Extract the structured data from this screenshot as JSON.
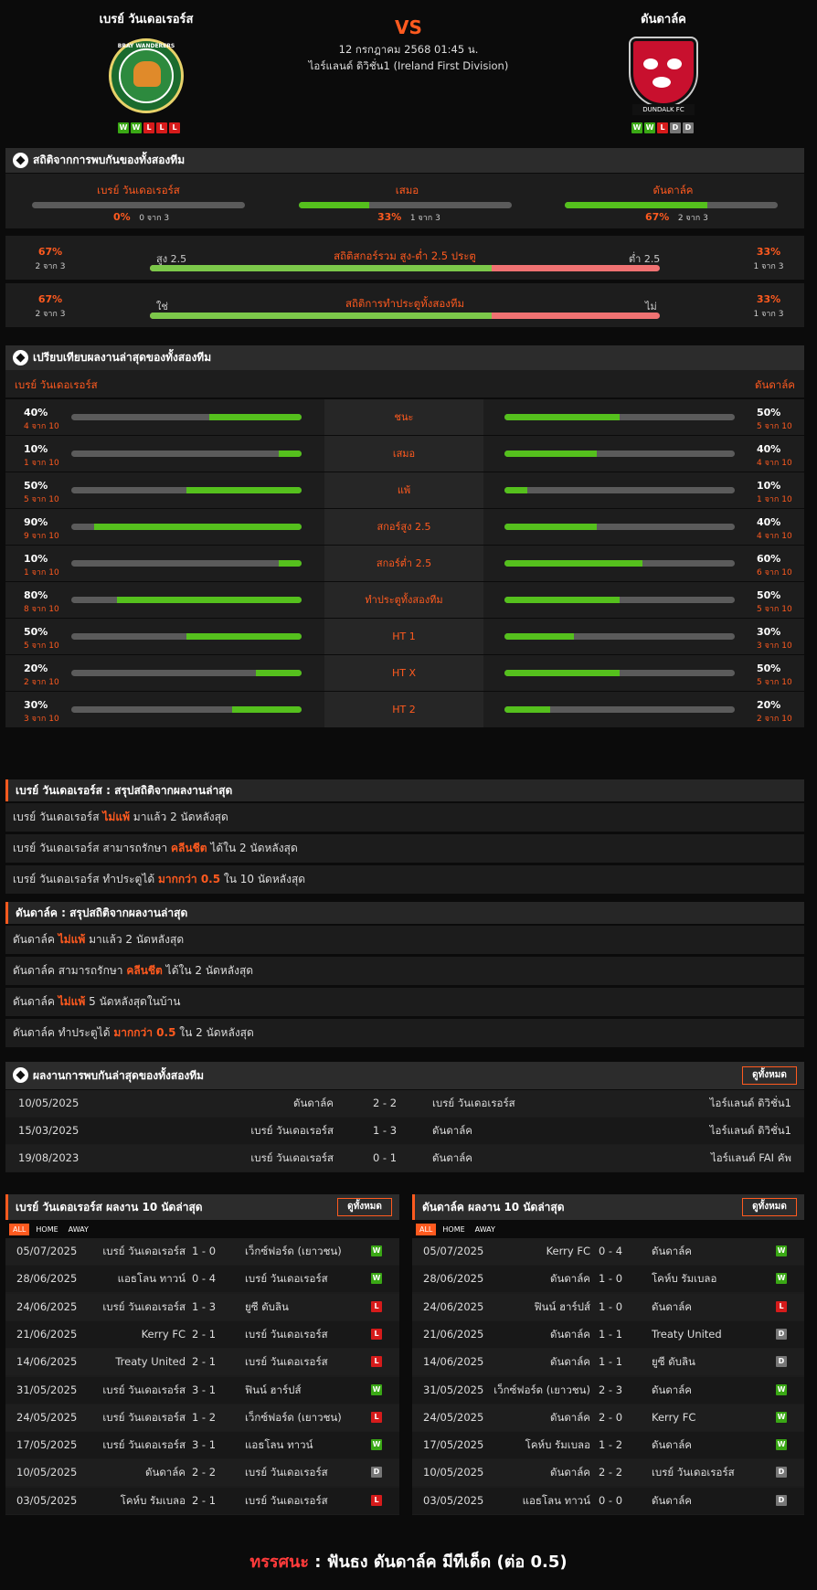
{
  "header": {
    "home": "เบรย์ วันเดอเรอร์ส",
    "away": "ดันดาล์ค",
    "vs": "VS",
    "datetime": "12 กรกฎาคม 2568 01:45 น.",
    "league": "ไอร์แลนด์ ดิวิชั่น1 (Ireland First Division)",
    "home_form": [
      "W",
      "W",
      "L",
      "L",
      "L"
    ],
    "away_form": [
      "W",
      "W",
      "L",
      "D",
      "D"
    ],
    "home_logo_text": "BRAY WANDERERS",
    "away_logo_text": "DUNDALK FC"
  },
  "h2h": {
    "title": "สถิติจากการพบกันของทั้งสองทีม",
    "home_label": "เบรย์ วันเดอเรอร์ส",
    "draw_label": "เสมอ",
    "away_label": "ดันดาล์ค",
    "home_pct": "0%",
    "home_cnt": "0 จาก 3",
    "home_val": 0,
    "draw_pct": "33%",
    "draw_cnt": "1 จาก 3",
    "draw_val": 33,
    "away_pct": "67%",
    "away_cnt": "2 จาก 3",
    "away_val": 67
  },
  "ou": {
    "title": "สถิติสกอร์รวม สูง-ต่ำ 2.5 ประตู",
    "left_pct": "67%",
    "left_cnt": "2 จาก 3",
    "left_label": "สูง 2.5",
    "right_label": "ต่ำ 2.5",
    "right_pct": "33%",
    "right_cnt": "1 จาก 3",
    "split": 67
  },
  "btts": {
    "title": "สถิติการทำประตูทั้งสองทีม",
    "left_pct": "67%",
    "left_cnt": "2 จาก 3",
    "left_label": "ใช่",
    "right_label": "ไม่",
    "right_pct": "33%",
    "right_cnt": "1 จาก 3",
    "split": 67
  },
  "compare": {
    "title": "เปรียบเทียบผลงานล่าสุดของทั้งสองทีม",
    "home": "เบรย์ วันเดอเรอร์ส",
    "away": "ดันดาล์ค",
    "rows": [
      {
        "label": "ชนะ",
        "hp": "40%",
        "hc": "4 จาก 10",
        "hv": 40,
        "ap": "50%",
        "ac": "5 จาก 10",
        "av": 50
      },
      {
        "label": "เสมอ",
        "hp": "10%",
        "hc": "1 จาก 10",
        "hv": 10,
        "ap": "40%",
        "ac": "4 จาก 10",
        "av": 40
      },
      {
        "label": "แพ้",
        "hp": "50%",
        "hc": "5 จาก 10",
        "hv": 50,
        "ap": "10%",
        "ac": "1 จาก 10",
        "av": 10
      },
      {
        "label": "สกอร์สูง 2.5",
        "hp": "90%",
        "hc": "9 จาก 10",
        "hv": 90,
        "ap": "40%",
        "ac": "4 จาก 10",
        "av": 40
      },
      {
        "label": "สกอร์ต่ำ 2.5",
        "hp": "10%",
        "hc": "1 จาก 10",
        "hv": 10,
        "ap": "60%",
        "ac": "6 จาก 10",
        "av": 60
      },
      {
        "label": "ทำประตูทั้งสองทีม",
        "hp": "80%",
        "hc": "8 จาก 10",
        "hv": 80,
        "ap": "50%",
        "ac": "5 จาก 10",
        "av": 50
      },
      {
        "label": "HT 1",
        "hp": "50%",
        "hc": "5 จาก 10",
        "hv": 50,
        "ap": "30%",
        "ac": "3 จาก 10",
        "av": 30
      },
      {
        "label": "HT X",
        "hp": "20%",
        "hc": "2 จาก 10",
        "hv": 20,
        "ap": "50%",
        "ac": "5 จาก 10",
        "av": 50
      },
      {
        "label": "HT 2",
        "hp": "30%",
        "hc": "3 จาก 10",
        "hv": 30,
        "ap": "20%",
        "ac": "2 จาก 10",
        "av": 20
      }
    ]
  },
  "home_summary": {
    "title": "เบรย์ วันเดอเรอร์ส : สรุปสถิติจากผลงานล่าสุด",
    "rows": [
      [
        "เบรย์ วันเดอเรอร์ส ",
        "ไม่แพ้",
        " มาแล้ว 2 นัดหลังสุด"
      ],
      [
        "เบรย์ วันเดอเรอร์ส  สามารถรักษา ",
        "คลีนชีต",
        " ได้ใน 2 นัดหลังสุด"
      ],
      [
        "เบรย์ วันเดอเรอร์ส  ทำประตูได้ ",
        "มากกว่า  0.5",
        " ใน 10 นัดหลังสุด"
      ]
    ]
  },
  "away_summary": {
    "title": "ดันดาล์ค : สรุปสถิติจากผลงานล่าสุด",
    "rows": [
      [
        "ดันดาล์ค ",
        "ไม่แพ้",
        " มาแล้ว 2 นัดหลังสุด"
      ],
      [
        "ดันดาล์ค  สามารถรักษา ",
        "คลีนชีต",
        " ได้ใน 2 นัดหลังสุด"
      ],
      [
        "ดันดาล์ค ",
        "ไม่แพ้",
        "  5  นัดหลังสุดในบ้าน"
      ],
      [
        "ดันดาล์ค  ทำประตูได้ ",
        "มากกว่า  0.5",
        " ใน 2 นัดหลังสุด"
      ]
    ]
  },
  "recent_h2h": {
    "title": "ผลงานการพบกันล่าสุดของทั้งสองทีม",
    "btn": "ดูทั้งหมด",
    "rows": [
      [
        "10/05/2025",
        "ดันดาล์ค",
        "2 - 2",
        "เบรย์ วันเดอเรอร์ส",
        "ไอร์แลนด์ ดิวิชั่น1"
      ],
      [
        "15/03/2025",
        "เบรย์ วันเดอเรอร์ส",
        "1 - 3",
        "ดันดาล์ค",
        "ไอร์แลนด์ ดิวิชั่น1"
      ],
      [
        "19/08/2023",
        "เบรย์ วันเดอเรอร์ส",
        "0 - 1",
        "ดันดาล์ค",
        "ไอร์แลนด์ FAI คัพ"
      ]
    ]
  },
  "home_last10": {
    "title": "เบรย์ วันเดอเรอร์ส ผลงาน 10 นัดล่าสุด",
    "btn": "ดูทั้งหมด",
    "tabs": [
      "ALL",
      "HOME",
      "AWAY"
    ],
    "rows": [
      [
        "05/07/2025",
        "เบรย์ วันเดอเรอร์ส",
        "1 - 0",
        "เว็กซ์ฟอร์ด (เยาวชน)",
        "W"
      ],
      [
        "28/06/2025",
        "แอธโลน ทาวน์",
        "0 - 4",
        "เบรย์ วันเดอเรอร์ส",
        "W"
      ],
      [
        "24/06/2025",
        "เบรย์ วันเดอเรอร์ส",
        "1 - 3",
        "ยูซี ดับลิน",
        "L"
      ],
      [
        "21/06/2025",
        "Kerry FC",
        "2 - 1",
        "เบรย์ วันเดอเรอร์ส",
        "L"
      ],
      [
        "14/06/2025",
        "Treaty United",
        "2 - 1",
        "เบรย์ วันเดอเรอร์ส",
        "L"
      ],
      [
        "31/05/2025",
        "เบรย์ วันเดอเรอร์ส",
        "3 - 1",
        "ฟินน์ ฮาร์ปส์",
        "W"
      ],
      [
        "24/05/2025",
        "เบรย์ วันเดอเรอร์ส",
        "1 - 2",
        "เว็กซ์ฟอร์ด (เยาวชน)",
        "L"
      ],
      [
        "17/05/2025",
        "เบรย์ วันเดอเรอร์ส",
        "3 - 1",
        "แอธโลน ทาวน์",
        "W"
      ],
      [
        "10/05/2025",
        "ดันดาล์ค",
        "2 - 2",
        "เบรย์ วันเดอเรอร์ส",
        "D"
      ],
      [
        "03/05/2025",
        "โคห์บ รัมเบลอ",
        "2 - 1",
        "เบรย์ วันเดอเรอร์ส",
        "L"
      ]
    ]
  },
  "away_last10": {
    "title": "ดันดาล์ค ผลงาน 10 นัดล่าสุด",
    "btn": "ดูทั้งหมด",
    "tabs": [
      "ALL",
      "HOME",
      "AWAY"
    ],
    "rows": [
      [
        "05/07/2025",
        "Kerry FC",
        "0 - 4",
        "ดันดาล์ค",
        "W"
      ],
      [
        "28/06/2025",
        "ดันดาล์ค",
        "1 - 0",
        "โคห์บ รัมเบลอ",
        "W"
      ],
      [
        "24/06/2025",
        "ฟินน์ ฮาร์ปส์",
        "1 - 0",
        "ดันดาล์ค",
        "L"
      ],
      [
        "21/06/2025",
        "ดันดาล์ค",
        "1 - 1",
        "Treaty United",
        "D"
      ],
      [
        "14/06/2025",
        "ดันดาล์ค",
        "1 - 1",
        "ยูซี ดับลิน",
        "D"
      ],
      [
        "31/05/2025",
        "เว็กซ์ฟอร์ด (เยาวชน)",
        "2 - 3",
        "ดันดาล์ค",
        "W"
      ],
      [
        "24/05/2025",
        "ดันดาล์ค",
        "2 - 0",
        "Kerry FC",
        "W"
      ],
      [
        "17/05/2025",
        "โคห์บ รัมเบลอ",
        "1 - 2",
        "ดันดาล์ค",
        "W"
      ],
      [
        "10/05/2025",
        "ดันดาล์ค",
        "2 - 2",
        "เบรย์ วันเดอเรอร์ส",
        "D"
      ],
      [
        "03/05/2025",
        "แอธโลน ทาวน์",
        "0 - 0",
        "ดันดาล์ค",
        "D"
      ]
    ]
  },
  "prediction": {
    "label": "ทรรศนะ",
    "sep": " : ",
    "text": "ฟันธง ดันดาล์ค มีทีเด็ด (ต่อ 0.5)"
  }
}
